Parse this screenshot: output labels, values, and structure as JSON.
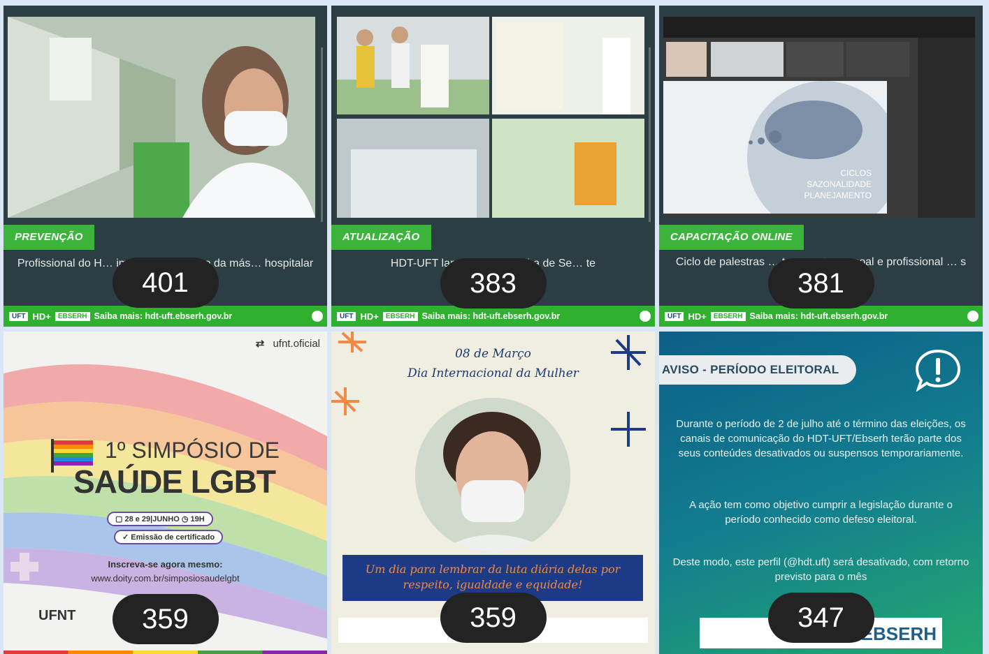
{
  "tiles": [
    {
      "tag": "PREVENÇÃO",
      "desc": "Profissional do H… importância do uso da más… hospitalar",
      "footer": "Saiba mais: hdt-uft.ebserh.gov.br",
      "count": "401"
    },
    {
      "tag": "ATUALIZAÇÃO",
      "desc": "HDT-UFT lança … da Cartilha de Se… te",
      "footer": "Saiba mais: hdt-uft.ebserh.gov.br",
      "count": "383"
    },
    {
      "tag": "CAPACITAÇÃO ONLINE",
      "desc": "Ciclo de palestras … toramento pessoal e profissional … s do HDT-UFT",
      "footer": "Saiba mais: hdt-uft.ebserh.gov.br",
      "count": "381",
      "slide_text": [
        "CICLOS",
        "SAZONALIDADE",
        "PLANEJAMENTO"
      ]
    }
  ],
  "logos": {
    "hdt": "HD+",
    "ebserh": "EBSERH",
    "uft": "UFT"
  },
  "lgbt": {
    "handle": "ufnt.oficial",
    "title1": "1º SIMPÓSIO DE",
    "title2": "SAÚDE LGBT",
    "date": "28 e 29|JUNHO",
    "time": "19H",
    "cert": "Emissão de certificado",
    "cta": "Inscreva-se agora mesmo:",
    "url": "www.doity.com.br/simposiosaudelgbt",
    "ufnt": "UFNT",
    "count": "359"
  },
  "mulher": {
    "date": "08 de Março",
    "day": "Dia Internacional da Mulher",
    "banner": "Um dia para lembrar da luta diária delas por respeito, igualdade e equidade!",
    "count": "359"
  },
  "aviso": {
    "badge": "AVISO - PERÍODO ELEITORAL",
    "p1": "Durante o período de 2 de julho até o término das eleições, os canais de comunicação do HDT-UFT/Ebserh terão parte dos seus conteúdes desativados ou suspensos temporariamente.",
    "p2": "A ação tem como objetivo cumprir a legislação durante o período conhecido como defeso eleitoral.",
    "p3": "Deste modo, este perfil (@hdt.uft) será desativado, com retorno previsto para o mês",
    "ebserh": "EBSERH",
    "count": "347"
  },
  "colors": {
    "green": "#2fb02e",
    "dark": "#2c3e44",
    "counter": "#232323"
  }
}
